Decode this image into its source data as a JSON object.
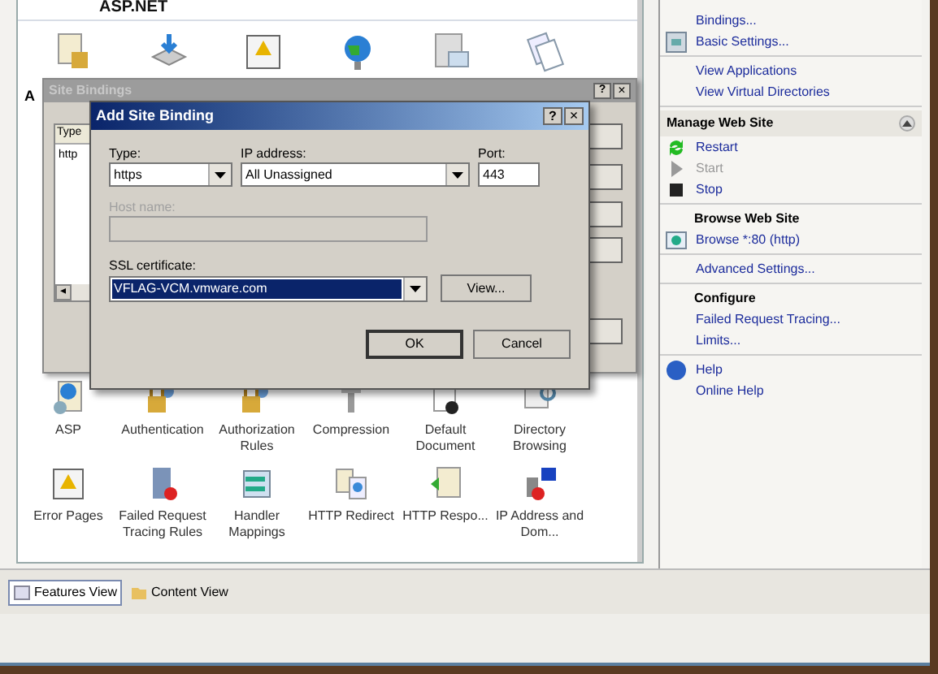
{
  "features": {
    "group_title": "ASP.NET",
    "partial_label": "A",
    "rows": [
      [
        {
          "label": "ASP"
        },
        {
          "label": "Authentication"
        },
        {
          "label": "Authorization Rules"
        },
        {
          "label": "Compression"
        },
        {
          "label": "Default Document"
        },
        {
          "label": "Directory Browsing"
        }
      ],
      [
        {
          "label": "Error Pages"
        },
        {
          "label": "Failed Request Tracing Rules"
        },
        {
          "label": "Handler Mappings"
        },
        {
          "label": "HTTP Redirect"
        },
        {
          "label": "HTTP Respo..."
        },
        {
          "label": "IP Address and Dom..."
        }
      ]
    ]
  },
  "site_bindings": {
    "title": "Site Bindings",
    "help": "?",
    "close": "×",
    "column": "Type",
    "row": "http",
    "scroll_left": "◂"
  },
  "add_binding": {
    "title": "Add Site Binding",
    "help": "?",
    "close": "×",
    "type": {
      "label": "Type:",
      "value": "https"
    },
    "ip": {
      "label": "IP address:",
      "value": "All Unassigned"
    },
    "port": {
      "label": "Port:",
      "value": "443"
    },
    "host": {
      "label": "Host name:",
      "disabled": true
    },
    "ssl": {
      "label": "SSL certificate:",
      "value": "VFLAG-VCM.vmware.com",
      "selected": true
    },
    "view_button": "View...",
    "ok": "OK",
    "cancel": "Cancel"
  },
  "actions": [
    [
      {
        "kind": "link",
        "text": "Bindings...",
        "disabled": false
      },
      {
        "kind": "link",
        "text": "Basic Settings...",
        "disabled": false
      }
    ],
    [
      {
        "kind": "link",
        "text": "View Applications",
        "disabled": false
      },
      {
        "kind": "link",
        "text": "View Virtual Directories",
        "disabled": false
      }
    ],
    [
      {
        "kind": "header",
        "text": "Manage Web Site",
        "expanded": true
      },
      {
        "kind": "link",
        "text": "Restart",
        "disabled": false
      },
      {
        "kind": "link",
        "text": "Start",
        "disabled": true
      },
      {
        "kind": "link",
        "text": "Stop",
        "disabled": false
      }
    ],
    [
      {
        "kind": "heading",
        "text": "Browse Web Site"
      },
      {
        "kind": "link",
        "text": "Browse *:80 (http)",
        "disabled": false
      }
    ],
    [
      {
        "kind": "link",
        "text": "Advanced Settings...",
        "disabled": false
      }
    ],
    [
      {
        "kind": "heading",
        "text": "Configure"
      },
      {
        "kind": "link",
        "text": "Failed Request Tracing...",
        "disabled": false
      },
      {
        "kind": "link",
        "text": "Limits...",
        "disabled": false
      }
    ],
    [
      {
        "kind": "link",
        "text": "Help",
        "disabled": false
      },
      {
        "kind": "link",
        "text": "Online Help",
        "disabled": false
      }
    ]
  ],
  "view_tabs": [
    {
      "label": "Features View",
      "selected": true
    },
    {
      "label": "Content View",
      "selected": false
    }
  ]
}
